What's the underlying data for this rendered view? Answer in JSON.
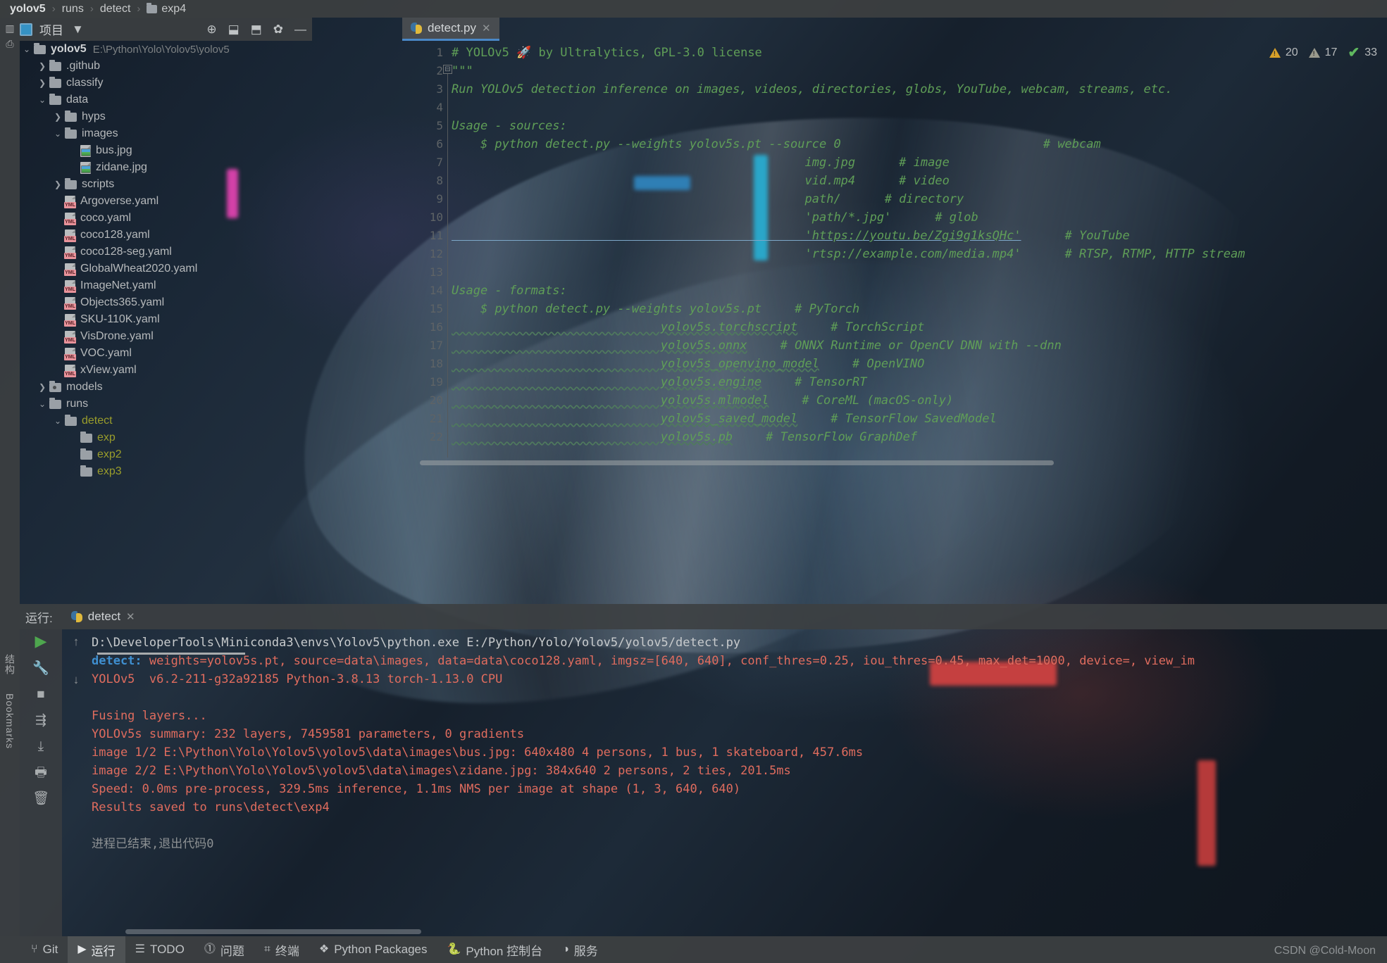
{
  "breadcrumb": {
    "items": [
      "yolov5",
      "runs",
      "detect",
      "exp4"
    ],
    "separator": "›"
  },
  "project_panel": {
    "title": "项目",
    "dropdown_caret": "▼",
    "actions": [
      {
        "name": "select-opened-file-icon",
        "glyph": "⊕"
      },
      {
        "name": "expand-all-icon",
        "glyph": "⬓"
      },
      {
        "name": "collapse-all-icon",
        "glyph": "⬒"
      },
      {
        "name": "settings-gear-icon",
        "glyph": "✿"
      },
      {
        "name": "hide-panel-icon",
        "glyph": "—"
      }
    ],
    "tree": [
      {
        "label": "yolov5",
        "note": "E:\\Python\\Yolo\\Yolov5\\yolov5",
        "indent": 0,
        "twisty": "v",
        "icon": "folder",
        "bold": true
      },
      {
        "label": ".github",
        "note": "",
        "indent": 1,
        "twisty": ">",
        "icon": "folder"
      },
      {
        "label": "classify",
        "note": "",
        "indent": 1,
        "twisty": ">",
        "icon": "folder"
      },
      {
        "label": "data",
        "note": "",
        "indent": 1,
        "twisty": "v",
        "icon": "folder"
      },
      {
        "label": "hyps",
        "note": "",
        "indent": 2,
        "twisty": ">",
        "icon": "folder"
      },
      {
        "label": "images",
        "note": "",
        "indent": 2,
        "twisty": "v",
        "icon": "folder"
      },
      {
        "label": "bus.jpg",
        "note": "",
        "indent": 3,
        "twisty": "",
        "icon": "image"
      },
      {
        "label": "zidane.jpg",
        "note": "",
        "indent": 3,
        "twisty": "",
        "icon": "image"
      },
      {
        "label": "scripts",
        "note": "",
        "indent": 2,
        "twisty": ">",
        "icon": "folder"
      },
      {
        "label": "Argoverse.yaml",
        "note": "",
        "indent": 2,
        "twisty": "",
        "icon": "yml"
      },
      {
        "label": "coco.yaml",
        "note": "",
        "indent": 2,
        "twisty": "",
        "icon": "yml"
      },
      {
        "label": "coco128.yaml",
        "note": "",
        "indent": 2,
        "twisty": "",
        "icon": "yml"
      },
      {
        "label": "coco128-seg.yaml",
        "note": "",
        "indent": 2,
        "twisty": "",
        "icon": "yml"
      },
      {
        "label": "GlobalWheat2020.yaml",
        "note": "",
        "indent": 2,
        "twisty": "",
        "icon": "yml"
      },
      {
        "label": "ImageNet.yaml",
        "note": "",
        "indent": 2,
        "twisty": "",
        "icon": "yml"
      },
      {
        "label": "Objects365.yaml",
        "note": "",
        "indent": 2,
        "twisty": "",
        "icon": "yml"
      },
      {
        "label": "SKU-110K.yaml",
        "note": "",
        "indent": 2,
        "twisty": "",
        "icon": "yml"
      },
      {
        "label": "VisDrone.yaml",
        "note": "",
        "indent": 2,
        "twisty": "",
        "icon": "yml"
      },
      {
        "label": "VOC.yaml",
        "note": "",
        "indent": 2,
        "twisty": "",
        "icon": "yml"
      },
      {
        "label": "xView.yaml",
        "note": "",
        "indent": 2,
        "twisty": "",
        "icon": "yml"
      },
      {
        "label": "models",
        "note": "",
        "indent": 1,
        "twisty": ">",
        "icon": "folder-dot"
      },
      {
        "label": "runs",
        "note": "",
        "indent": 1,
        "twisty": "v",
        "icon": "folder"
      },
      {
        "label": "detect",
        "note": "",
        "indent": 2,
        "twisty": "v",
        "icon": "folder",
        "olive": true
      },
      {
        "label": "exp",
        "note": "",
        "indent": 3,
        "twisty": "",
        "icon": "folder",
        "olive": true
      },
      {
        "label": "exp2",
        "note": "",
        "indent": 3,
        "twisty": "",
        "icon": "folder",
        "olive": true
      },
      {
        "label": "exp3",
        "note": "",
        "indent": 3,
        "twisty": "",
        "icon": "folder",
        "olive": true
      }
    ]
  },
  "editor": {
    "tab": {
      "label": "detect.py",
      "icon": "python-file-icon",
      "close": "✕"
    },
    "inspections": {
      "warnings": "20",
      "weak_warnings": "17",
      "ok": "33"
    },
    "first_line": 1,
    "lines": [
      {
        "n": 1,
        "segments": [
          {
            "t": "# YOLOv5 🚀 by Ultralytics, GPL-3.0 license",
            "c": "com"
          }
        ]
      },
      {
        "n": 2,
        "segments": [
          {
            "t": "\"\"\"",
            "c": "doc"
          }
        ]
      },
      {
        "n": 3,
        "segments": [
          {
            "t": "Run YOLOv5 detection inference on images, videos, directories, globs, YouTube, webcam, streams, etc.",
            "c": "doc"
          }
        ]
      },
      {
        "n": 4,
        "segments": [
          {
            "t": "",
            "c": "doc"
          }
        ]
      },
      {
        "n": 5,
        "segments": [
          {
            "t": "Usage - sources:",
            "c": "doc"
          }
        ]
      },
      {
        "n": 6,
        "segments": [
          {
            "t": "    $ python detect.py --weights yolov5s.pt --source 0",
            "c": "doc"
          },
          {
            "t": "                      # webcam",
            "c": "doc",
            "pad": 62
          }
        ]
      },
      {
        "n": 7,
        "segments": [
          {
            "t": "                                                 img.jpg",
            "c": "doc"
          },
          {
            "t": "# image",
            "c": "doc",
            "pad": 62
          }
        ]
      },
      {
        "n": 8,
        "segments": [
          {
            "t": "                                                 vid.mp4",
            "c": "doc"
          },
          {
            "t": "# video",
            "c": "doc",
            "pad": 62
          }
        ]
      },
      {
        "n": 9,
        "segments": [
          {
            "t": "                                                 path/",
            "c": "doc"
          },
          {
            "t": "# directory",
            "c": "doc",
            "pad": 62
          }
        ]
      },
      {
        "n": 10,
        "segments": [
          {
            "t": "                                                 'path/*.jpg'",
            "c": "doc"
          },
          {
            "t": "# glob",
            "c": "doc",
            "pad": 62
          }
        ]
      },
      {
        "n": 11,
        "segments": [
          {
            "t": "                                                 'https://youtu.be/Zgi9g1ksQHc'",
            "c": "doc ul"
          },
          {
            "t": "# YouTube",
            "c": "doc",
            "pad": 62
          }
        ]
      },
      {
        "n": 12,
        "segments": [
          {
            "t": "                                                 'rtsp://example.com/media.mp4'",
            "c": "doc"
          },
          {
            "t": "# RTSP, RTMP, HTTP stream",
            "c": "doc",
            "pad": 62
          }
        ]
      },
      {
        "n": 13,
        "segments": [
          {
            "t": "",
            "c": "doc"
          }
        ]
      },
      {
        "n": 14,
        "segments": [
          {
            "t": "Usage - formats:",
            "c": "doc"
          }
        ]
      },
      {
        "n": 15,
        "segments": [
          {
            "t": "    $ python detect.py --weights yolov5s.pt",
            "c": "doc"
          },
          {
            "t": "# PyTorch",
            "c": "doc",
            "pad": 47
          }
        ]
      },
      {
        "n": 16,
        "segments": [
          {
            "t": "                             yolov5s.torchscript",
            "c": "doc wavy"
          },
          {
            "t": "# TorchScript",
            "c": "doc",
            "pad": 47
          }
        ]
      },
      {
        "n": 17,
        "segments": [
          {
            "t": "                             yolov5s.onnx",
            "c": "doc wavy"
          },
          {
            "t": "# ONNX Runtime or OpenCV DNN with --dnn",
            "c": "doc",
            "pad": 47
          }
        ]
      },
      {
        "n": 18,
        "segments": [
          {
            "t": "                             yolov5s_openvino_model",
            "c": "doc wavy"
          },
          {
            "t": "# OpenVINO",
            "c": "doc",
            "pad": 47
          }
        ]
      },
      {
        "n": 19,
        "segments": [
          {
            "t": "                             yolov5s.engine",
            "c": "doc wavy"
          },
          {
            "t": "# TensorRT",
            "c": "doc",
            "pad": 47
          }
        ]
      },
      {
        "n": 20,
        "segments": [
          {
            "t": "                             yolov5s.mlmodel",
            "c": "doc wavy"
          },
          {
            "t": "# CoreML (macOS-only)",
            "c": "doc",
            "pad": 47
          }
        ]
      },
      {
        "n": 21,
        "segments": [
          {
            "t": "                             yolov5s_saved_model",
            "c": "doc wavy"
          },
          {
            "t": "# TensorFlow SavedModel",
            "c": "doc",
            "pad": 47
          }
        ]
      },
      {
        "n": 22,
        "segments": [
          {
            "t": "                             yolov5s.pb",
            "c": "doc wavy"
          },
          {
            "t": "# TensorFlow GraphDef",
            "c": "doc",
            "pad": 47
          }
        ]
      }
    ]
  },
  "run_window": {
    "label": "运行:",
    "tab_name": "detect",
    "tab_close": "✕",
    "sidebar_buttons": [
      {
        "name": "rerun-button",
        "glyph": "▶"
      },
      {
        "name": "settings-wrench-icon",
        "glyph": "🔧"
      },
      {
        "name": "stop-button",
        "glyph": "■"
      },
      {
        "name": "soft-wrap-icon",
        "glyph": "⇶"
      },
      {
        "name": "scroll-to-end-icon",
        "glyph": "⤓"
      },
      {
        "name": "print-icon",
        "glyph": "🖶"
      },
      {
        "name": "clear-all-icon",
        "glyph": "🗑"
      }
    ],
    "gutter_buttons": [
      {
        "name": "up-arrow-icon",
        "glyph": "↑"
      },
      {
        "name": "down-arrow-icon",
        "glyph": "↓"
      }
    ],
    "console_lines": [
      {
        "cls": "o-white",
        "text": "D:\\DeveloperTools\\Miniconda3\\envs\\Yolov5\\python.exe E:/Python/Yolo/Yolov5/yolov5/detect.py"
      },
      {
        "cls": "o-red",
        "prefix": "detect: ",
        "prefix_cls": "o-blue",
        "text": "weights=yolov5s.pt, source=data\\images, data=data\\coco128.yaml, imgsz=[640, 640], conf_thres=0.25, iou_thres=0.45, max_det=1000, device=, view_im"
      },
      {
        "cls": "o-red",
        "text": "YOLOv5  v6.2-211-g32a92185 Python-3.8.13 torch-1.13.0 CPU"
      },
      {
        "cls": "o-red",
        "text": ""
      },
      {
        "cls": "o-red",
        "text": "Fusing layers..."
      },
      {
        "cls": "o-red",
        "text": "YOLOv5s summary: 232 layers, 7459581 parameters, 0 gradients"
      },
      {
        "cls": "o-red",
        "text": "image 1/2 E:\\Python\\Yolo\\Yolov5\\yolov5\\data\\images\\bus.jpg: 640x480 4 persons, 1 bus, 1 skateboard, 457.6ms"
      },
      {
        "cls": "o-red",
        "text": "image 2/2 E:\\Python\\Yolo\\Yolov5\\yolov5\\data\\images\\zidane.jpg: 384x640 2 persons, 2 ties, 201.5ms"
      },
      {
        "cls": "o-red",
        "text": "Speed: 0.0ms pre-process, 329.5ms inference, 1.1ms NMS per image at shape (1, 3, 640, 640)"
      },
      {
        "cls": "o-red",
        "text": "Results saved to runs\\detect\\exp4"
      },
      {
        "cls": "o-red",
        "text": ""
      },
      {
        "cls": "o-grey",
        "text": "进程已结束,退出代码0"
      }
    ]
  },
  "status_bar": {
    "items": [
      {
        "label": "Git",
        "icon": "git-branch-icon",
        "glyph": "⑂",
        "active": false
      },
      {
        "label": "运行",
        "icon": "run-icon",
        "glyph": "▶",
        "active": true
      },
      {
        "label": "TODO",
        "icon": "todo-list-icon",
        "glyph": "☰",
        "active": false
      },
      {
        "label": "问题",
        "icon": "problems-icon",
        "glyph": "⓵",
        "active": false
      },
      {
        "label": "终端",
        "icon": "terminal-icon",
        "glyph": "⌗",
        "active": false
      },
      {
        "label": "Python Packages",
        "icon": "packages-icon",
        "glyph": "❖",
        "active": false
      },
      {
        "label": "Python 控制台",
        "icon": "python-console-icon",
        "glyph": "🐍",
        "active": false
      },
      {
        "label": "服务",
        "icon": "services-icon",
        "glyph": "◑",
        "active": false
      }
    ]
  },
  "left_rail": {
    "labels": [
      "结构",
      "Bookmarks"
    ],
    "top_icons": [
      {
        "name": "project-view-icon",
        "glyph": "▥"
      },
      {
        "name": "commit-icon",
        "glyph": "⎙"
      }
    ]
  },
  "watermark": "CSDN @Cold-Moon",
  "colors": {
    "accent_blue": "#4a88c7",
    "console_red": "#e06c5e",
    "console_blue": "#3f8fd0",
    "comment_green": "#5f9e57",
    "olive_folder": "#9a9d2b",
    "panel_bg": "#3c3f41"
  }
}
